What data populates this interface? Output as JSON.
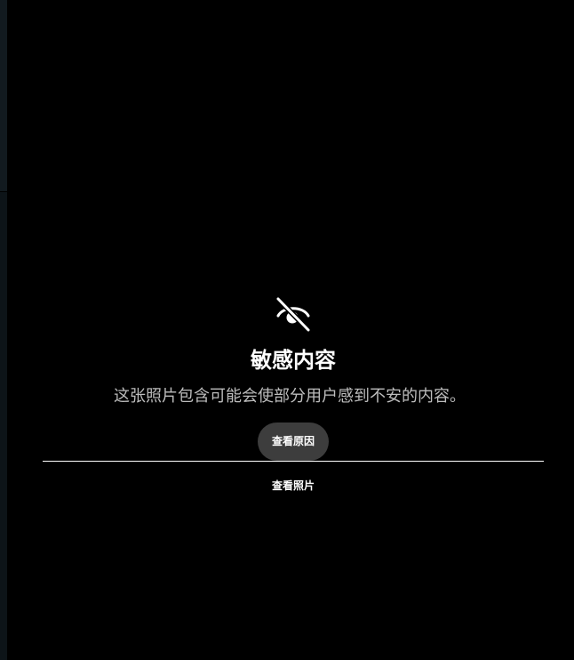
{
  "warning": {
    "icon": "eye-slash-icon",
    "title": "敏感内容",
    "description": "这张照片包含可能会使部分用户感到不安的内容。",
    "reason_button_label": "查看原因",
    "view_photo_label": "查看照片"
  },
  "colors": {
    "background": "#000000",
    "title_text": "#ffffff",
    "description_text": "#bdbdbd",
    "button_bg": "#3d3d3d"
  }
}
